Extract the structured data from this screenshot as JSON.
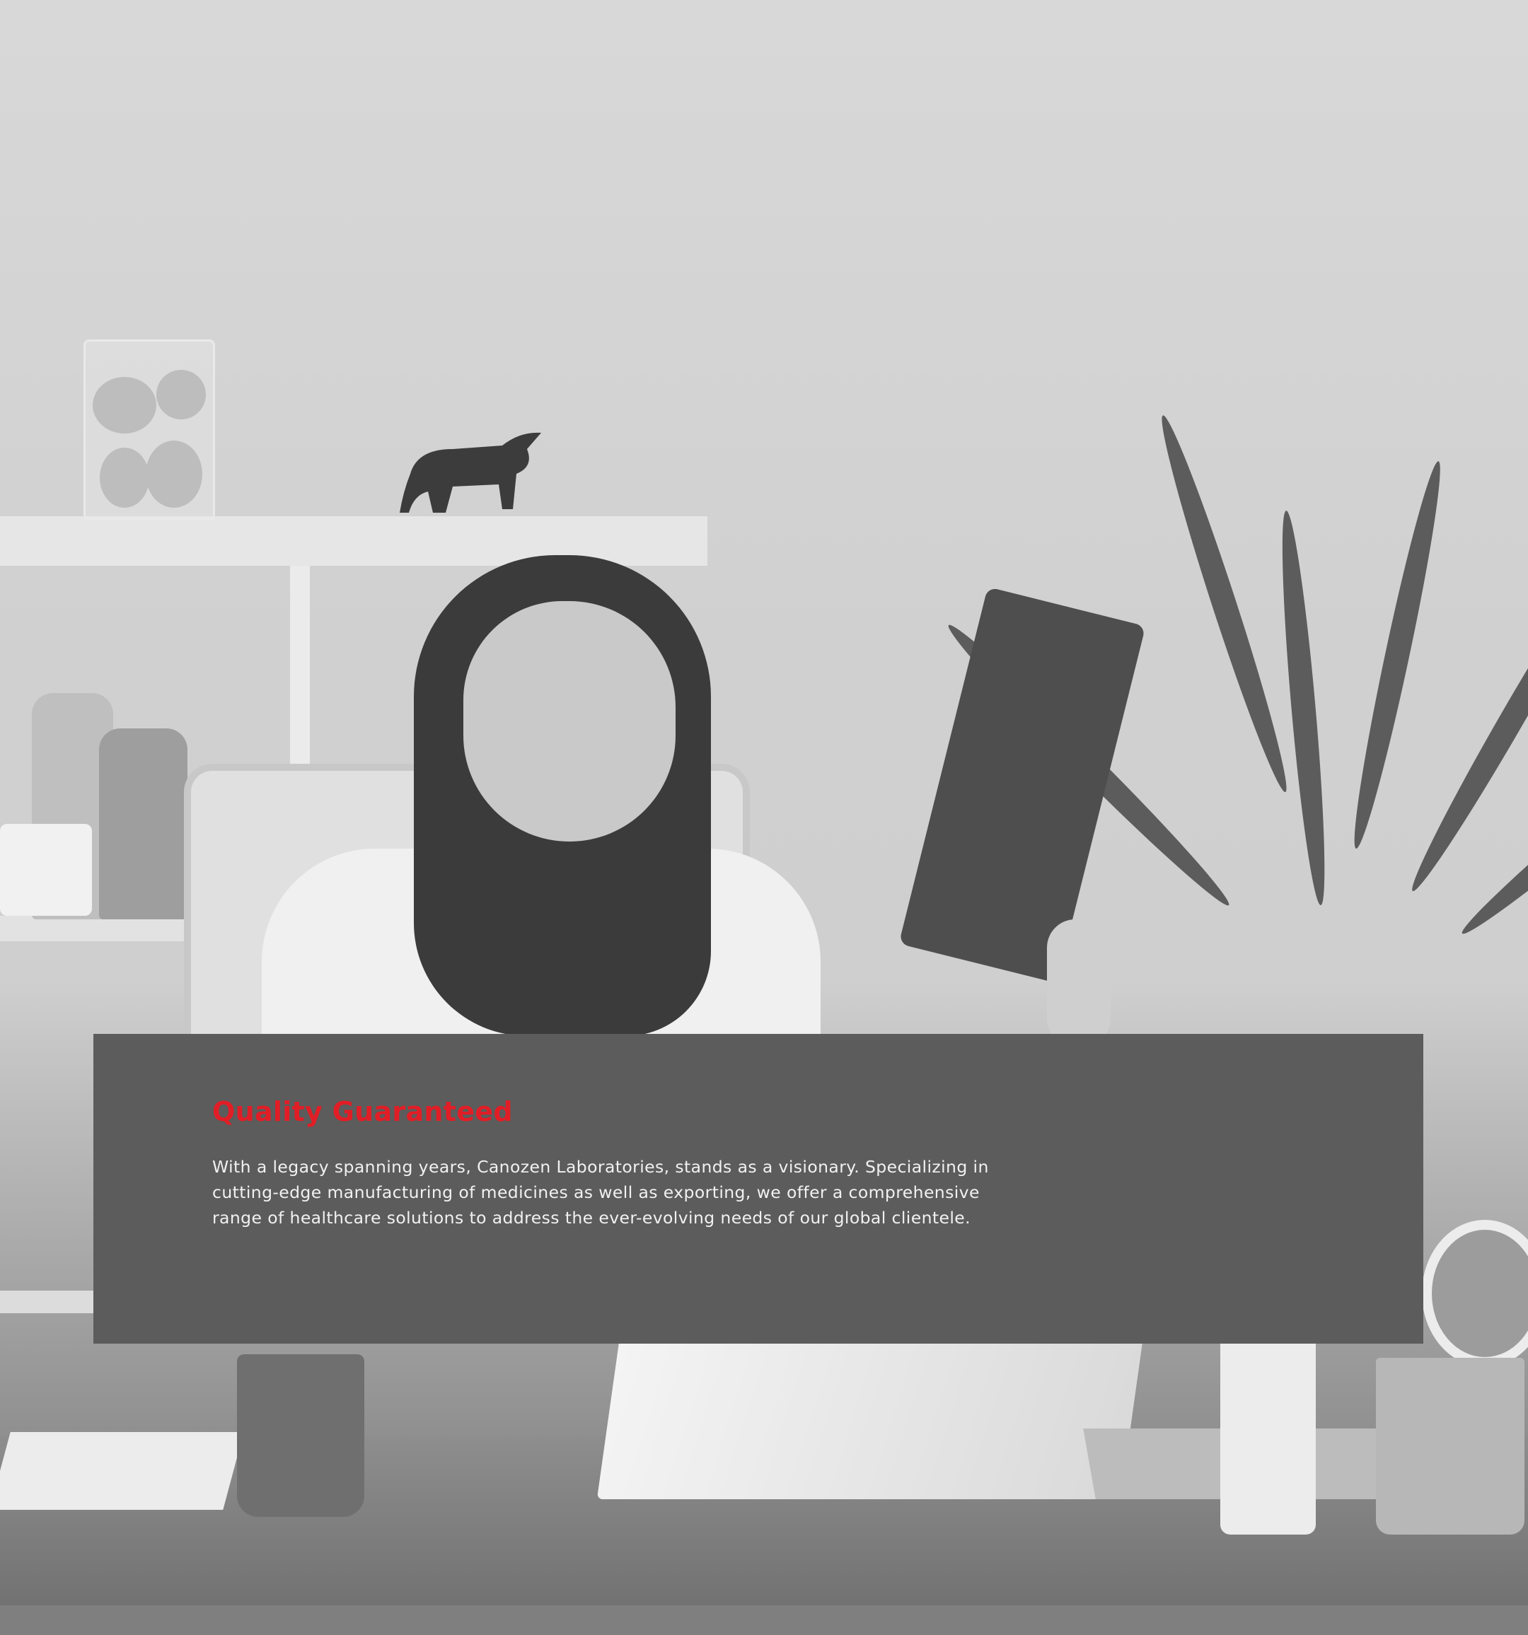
{
  "background": {
    "image_description_icon": "doctor-examining-xray-photo"
  },
  "feature": {
    "title": "Quality Guaranteed",
    "body": "With a legacy spanning years, Canozen Laboratories, stands as a visionary. Specializing in cutting-edge manufacturing of medicines as well as exporting, we offer a comprehensive range of healthcare solutions to address the ever-evolving needs of our global clientele."
  },
  "colors": {
    "title_accent": "#e11d26",
    "panel_background": "#5c5c5c",
    "body_text": "#f1f1f1"
  }
}
